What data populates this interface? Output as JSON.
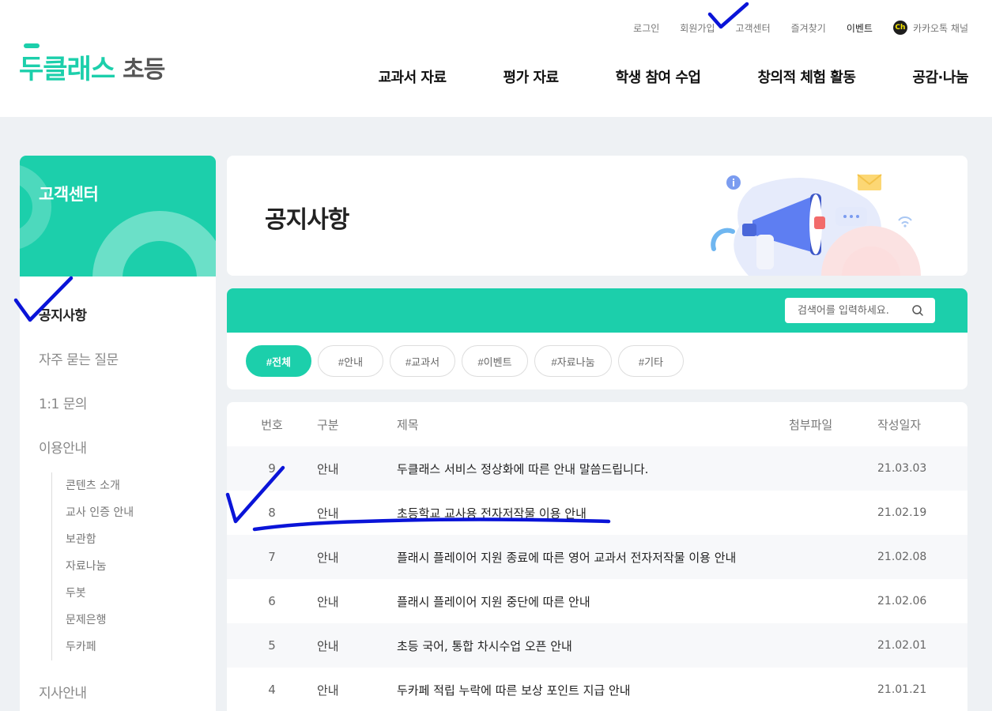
{
  "header": {
    "logo_main": "두클래스",
    "logo_sub": "초등",
    "util_links": [
      "로그인",
      "회원가입",
      "고객센터",
      "즐겨찾기",
      "이벤트"
    ],
    "kakao_icon_text": "Ch",
    "kakao_label": "카카오톡 채널",
    "gnb": [
      "교과서 자료",
      "평가 자료",
      "학생 참여 수업",
      "창의적 체험 활동",
      "공감·나눔"
    ]
  },
  "sidebar": {
    "title": "고객센터",
    "items": [
      {
        "label": "공지사항",
        "active": true
      },
      {
        "label": "자주 묻는 질문"
      },
      {
        "label": "1:1 문의"
      },
      {
        "label": "이용안내"
      }
    ],
    "sub_items": [
      "콘텐츠 소개",
      "교사 인증 안내",
      "보관함",
      "자료나눔",
      "두봇",
      "문제은행",
      "두카페"
    ],
    "last_item": "지사안내"
  },
  "banner": {
    "title": "공지사항"
  },
  "filter": {
    "search_placeholder": "검색어를 입력하세요.",
    "chips": [
      "#전체",
      "#안내",
      "#교과서",
      "#이벤트",
      "#자료나눔",
      "#기타"
    ],
    "active_chip": "#전체"
  },
  "table": {
    "headers": [
      "번호",
      "구분",
      "제목",
      "첨부파일",
      "작성일자"
    ],
    "rows": [
      {
        "no": "9",
        "cat": "안내",
        "title": "두클래스 서비스 정상화에 따른 안내 말씀드립니다.",
        "file": "",
        "date": "21.03.03"
      },
      {
        "no": "8",
        "cat": "안내",
        "title": "초등학교 교사용 전자저작물 이용 안내",
        "file": "",
        "date": "21.02.19"
      },
      {
        "no": "7",
        "cat": "안내",
        "title": "플래시 플레이어 지원 종료에 따른 영어 교과서 전자저작물 이용 안내",
        "file": "",
        "date": "21.02.08"
      },
      {
        "no": "6",
        "cat": "안내",
        "title": "플래시 플레이어 지원 중단에 따른 안내",
        "file": "",
        "date": "21.02.06"
      },
      {
        "no": "5",
        "cat": "안내",
        "title": "초등 국어, 통합 차시수업 오픈 안내",
        "file": "",
        "date": "21.02.01"
      },
      {
        "no": "4",
        "cat": "안내",
        "title": "두카페 적립 누락에 따른 보상 포인트 지급 안내",
        "file": "",
        "date": "21.01.21"
      }
    ]
  },
  "colors": {
    "brand": "#1ccfab",
    "annotation": "#0a14d8"
  }
}
